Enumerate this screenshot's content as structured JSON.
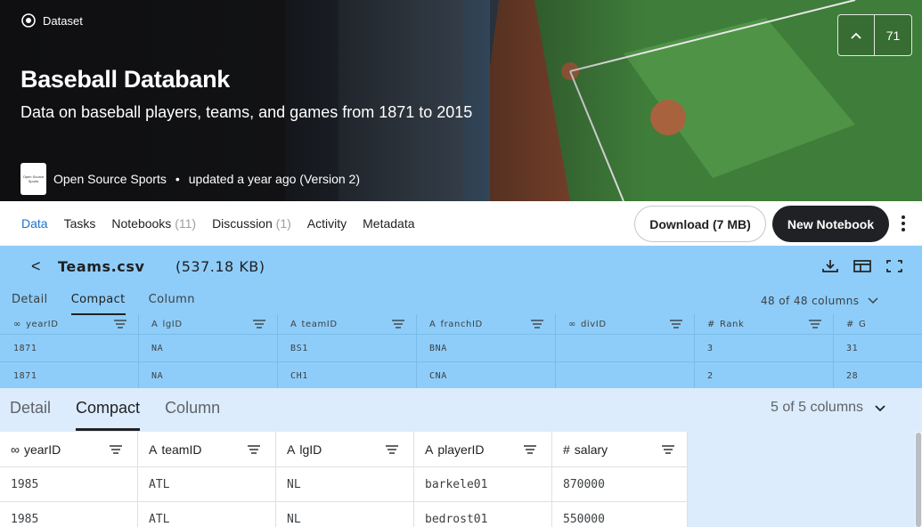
{
  "hero": {
    "breadcrumb": "Dataset",
    "title": "Baseball Databank",
    "subtitle": "Data on baseball players, teams, and games from 1871 to 2015",
    "owner_logo_text": "Open Source Sports",
    "owner": "Open Source Sports",
    "updated": "updated a year ago (Version 2)",
    "vote_icon": "chevron-up-icon",
    "vote_count": "71"
  },
  "nav": {
    "tabs": [
      {
        "label": "Data",
        "count": ""
      },
      {
        "label": "Tasks",
        "count": ""
      },
      {
        "label": "Notebooks",
        "count": "(11)"
      },
      {
        "label": "Discussion",
        "count": "(1)"
      },
      {
        "label": "Activity",
        "count": ""
      },
      {
        "label": "Metadata",
        "count": ""
      }
    ],
    "active_tab": "Data",
    "download_label": "Download (7 MB)",
    "new_notebook_label": "New Notebook"
  },
  "file_panel": {
    "back_icon": "chevron-left-icon",
    "file_name": "Teams.csv",
    "file_size": "(537.18 KB)",
    "views": [
      "Detail",
      "Compact",
      "Column"
    ],
    "active_view": "Compact",
    "column_count": "48 of 48 columns",
    "columns": [
      {
        "type_icon": "∞",
        "name": "yearID"
      },
      {
        "type_icon": "A",
        "name": "lgID"
      },
      {
        "type_icon": "A",
        "name": "teamID"
      },
      {
        "type_icon": "A",
        "name": "franchID"
      },
      {
        "type_icon": "∞",
        "name": "divID"
      },
      {
        "type_icon": "#",
        "name": "Rank"
      },
      {
        "type_icon": "#",
        "name": "G"
      }
    ],
    "rows": [
      [
        "1871",
        "NA",
        "BS1",
        "BNA",
        "",
        "3",
        "31"
      ],
      [
        "1871",
        "NA",
        "CH1",
        "CNA",
        "",
        "2",
        "28"
      ]
    ]
  },
  "lower_panel": {
    "views": [
      "Detail",
      "Compact",
      "Column"
    ],
    "active_view": "Compact",
    "column_count": "5 of 5 columns",
    "columns": [
      {
        "type_icon": "∞",
        "name": "yearID"
      },
      {
        "type_icon": "A",
        "name": "teamID"
      },
      {
        "type_icon": "A",
        "name": "lgID"
      },
      {
        "type_icon": "A",
        "name": "playerID"
      },
      {
        "type_icon": "#",
        "name": "salary"
      }
    ],
    "rows": [
      [
        "1985",
        "ATL",
        "NL",
        "barkele01",
        "870000"
      ],
      [
        "1985",
        "ATL",
        "NL",
        "bedrost01",
        "550000"
      ]
    ]
  },
  "colors": {
    "file_panel_bg": "#8ecdf9",
    "lower_panel_bg": "#dcecfc",
    "active_tab": "#1a73c8",
    "primary_button": "#202124"
  }
}
